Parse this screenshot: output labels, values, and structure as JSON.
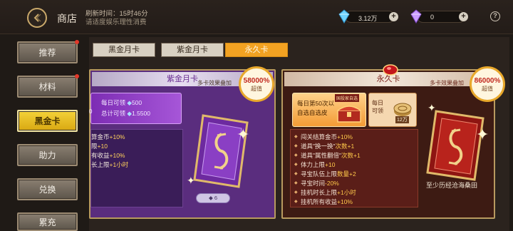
{
  "header": {
    "title": "商店",
    "refresh_line1": "刷新时间：15时46分",
    "refresh_line2": "请适度娱乐理性消费"
  },
  "currency": [
    {
      "name": "gold-gem",
      "value": "3.12万",
      "plus": "+"
    },
    {
      "name": "purple-gem",
      "value": "0",
      "plus": "+"
    }
  ],
  "help_label": "?",
  "sidebar": {
    "items": [
      {
        "label": "推荐",
        "badge": true,
        "active": false
      },
      {
        "label": "材料",
        "badge": true,
        "active": false
      },
      {
        "label": "黑金卡",
        "badge": false,
        "active": true
      },
      {
        "label": "助力",
        "badge": false,
        "active": false
      },
      {
        "label": "兑换",
        "badge": false,
        "active": false
      },
      {
        "label": "累充",
        "badge": false,
        "active": false
      }
    ]
  },
  "tabs": [
    {
      "label": "黑金月卡",
      "active": false
    },
    {
      "label": "紫金月卡",
      "active": false
    },
    {
      "label": "永久卡",
      "active": true
    }
  ],
  "purple_card": {
    "title": "紫金月卡",
    "stack_note": "多卡效果叠加",
    "value_badge": "58000%",
    "value_sub": "超值",
    "daily_line1": "每日可领",
    "daily_value1": "500",
    "daily_line2": "总计可领",
    "daily_value2": "1.5500",
    "side_digit": "0",
    "perks": [
      {
        "label": "算金币",
        "value": "+10%"
      },
      {
        "label": "限",
        "value": "+10"
      },
      {
        "label": "有收益",
        "value": "+10%"
      },
      {
        "label": "长上限",
        "value": "+1小时"
      }
    ],
    "price": "6"
  },
  "perm_card": {
    "title": "永久卡",
    "stack_note": "多卡效果叠加",
    "value_badge": "86000%",
    "value_sub": "超值",
    "offer_line1": "每日第50次以",
    "offer_line2": "自选自选皮",
    "offer_tag": "国投家自选",
    "daily_line1": "每日",
    "daily_line2": "可领",
    "coin_label": "12万",
    "perks": [
      {
        "label": "闯关结算金币",
        "value": "+10%"
      },
      {
        "label": "道具\"换一换\"",
        "value": "次数+1"
      },
      {
        "label": "道具\"属性翻倍\"",
        "value": "次数+1"
      },
      {
        "label": "体力上限",
        "value": "+10"
      },
      {
        "label": "寻宝队伍上限",
        "value": "数量+2"
      },
      {
        "label": "寻宝时间",
        "value": "-20%"
      },
      {
        "label": "挂机时长上限",
        "value": "+1小时"
      },
      {
        "label": "挂机所有收益",
        "value": "+10%"
      }
    ],
    "caption": "至少历经沧海桑田"
  }
}
